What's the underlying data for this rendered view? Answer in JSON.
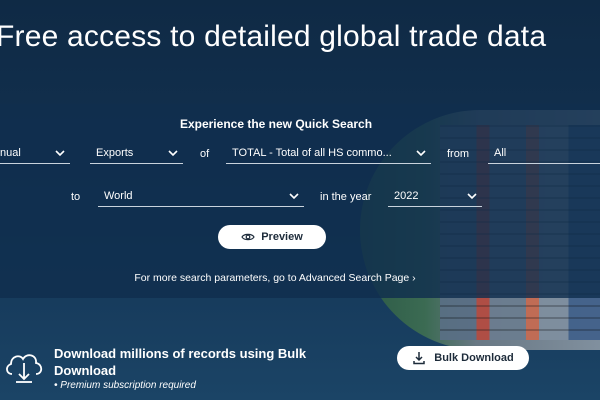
{
  "hero": {
    "title": "Free access to detailed global trade data"
  },
  "quick_search": {
    "title": "Experience the new Quick Search",
    "frequency": "nual",
    "flow": "Exports",
    "of_label": "of",
    "product": "TOTAL - Total of all HS commo...",
    "from_label": "from",
    "reporter": "All",
    "to_label": "to",
    "partner": "World",
    "year_label": "in the year",
    "year": "2022",
    "preview_label": "Preview",
    "advanced_link": "For more search parameters, go to Advanced Search Page",
    "advanced_chevron": "›"
  },
  "bulk": {
    "title": "Download millions of records using Bulk Download",
    "note": "• Premium subscription required",
    "button_label": "Bulk Download"
  },
  "icons": {
    "chevron": "chevron-down-icon",
    "eye": "eye-icon",
    "cloud": "cloud-download-icon",
    "download": "download-icon"
  }
}
